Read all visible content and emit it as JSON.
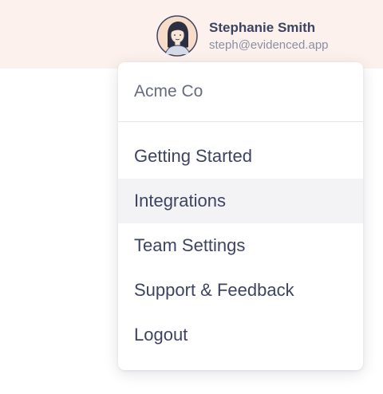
{
  "user": {
    "name": "Stephanie Smith",
    "email": "steph@evidenced.app"
  },
  "menu": {
    "organization": "Acme Co",
    "items": [
      {
        "label": "Getting Started"
      },
      {
        "label": "Integrations",
        "highlighted": true
      },
      {
        "label": "Team Settings"
      },
      {
        "label": "Support & Feedback"
      },
      {
        "label": "Logout"
      }
    ]
  },
  "colors": {
    "header_background": "#fdf1ed",
    "text_primary": "#3d4462",
    "text_secondary": "#8a8fa3",
    "hover_background": "#f3f3f5"
  }
}
